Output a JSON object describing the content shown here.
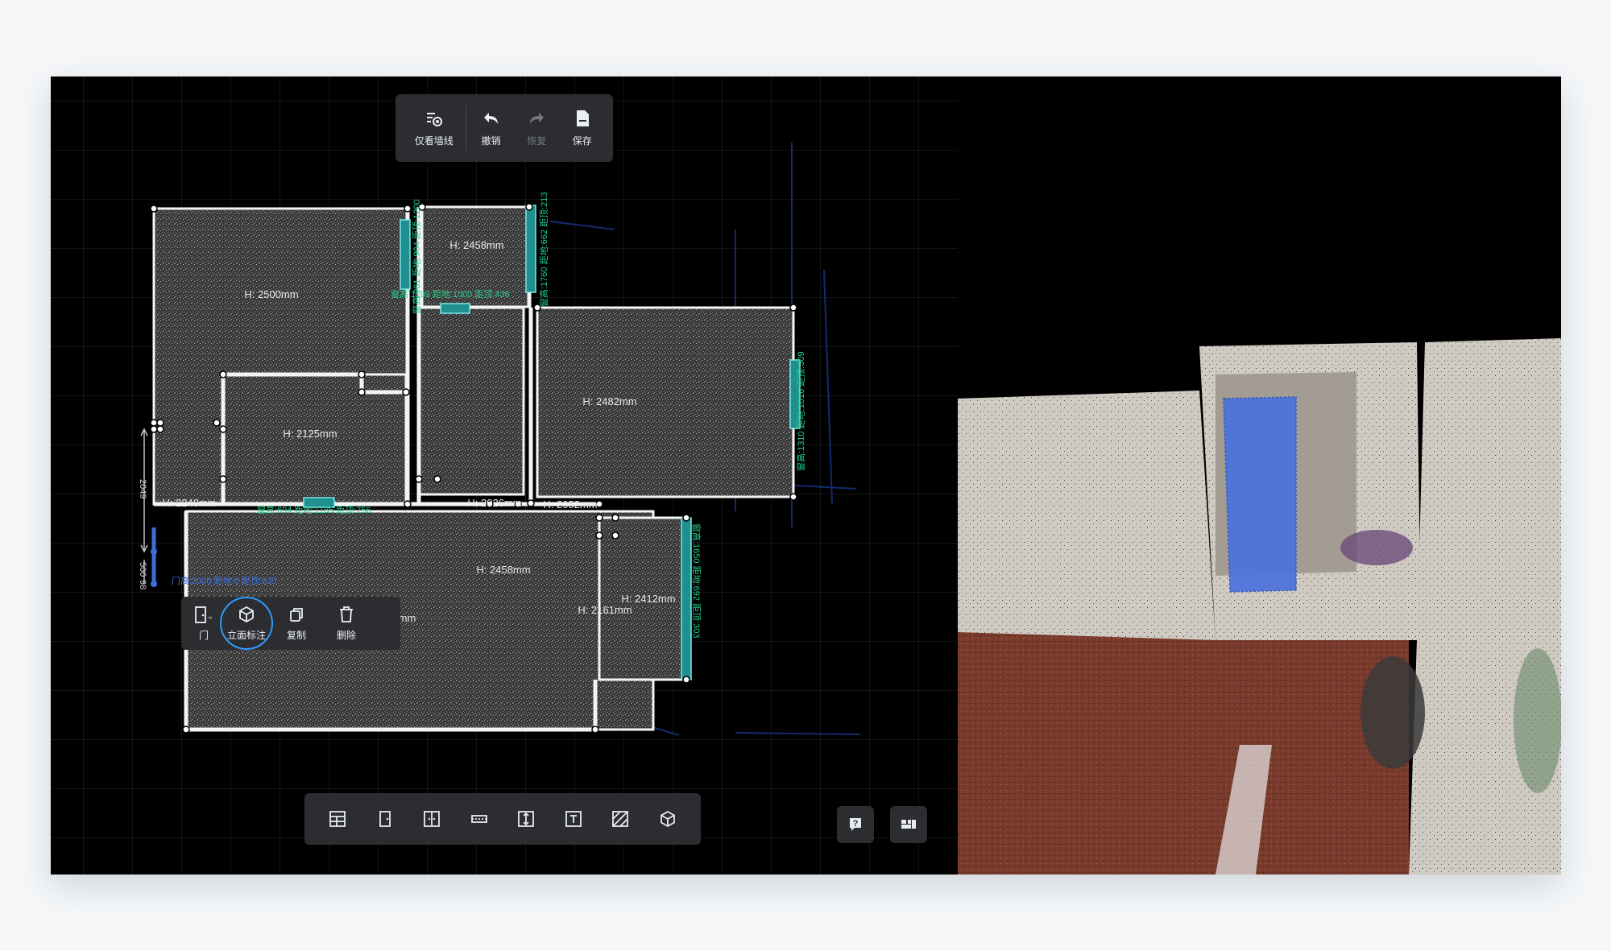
{
  "top_toolbar": {
    "walls_only": "仅看墙线",
    "undo": "撤销",
    "redo": "恢复",
    "save": "保存"
  },
  "context_toolbar": {
    "door": "门",
    "elevation": "立面标注",
    "copy": "复制",
    "delete": "删除"
  },
  "rooms": {
    "r1": "H: 2500mm",
    "r2": "H: 2458mm",
    "r3": "H: 2125mm",
    "r4": "H: 2482mm",
    "r5": "H: 2240mm",
    "r6": "H: 2026mm",
    "r7": "H: 2052mm",
    "r8": "H: 2458mm",
    "r9": "H: 2412mm",
    "r10": "H: 2161mm",
    "r11_partial": "2478mm"
  },
  "annotations": {
    "win_top_left": "窗高:1199 距地:1000 距顶:436",
    "win_v1": "窗高:961 距地:904 距顶:1200",
    "win_v2": "窗高:1760 距地:662 距顶:213",
    "win_right": "窗高:1310 距地:1016 距顶:309",
    "win_bottom_mid": "窗高:694 距地:1185 距顶:756",
    "win_right_lower": "窗高:1650 距地:692 距顶:303",
    "door_label": "门高:2000 距地:0 距顶:635",
    "dim_2049": "2049",
    "dim_500": "500",
    "dim_98": "98"
  },
  "colors": {
    "accent": "#2e9bff",
    "window_green": "#1fd08a",
    "window_fill": "#1f8f8f",
    "door_blue": "#3e6fd8",
    "toolbar_bg": "#2b2d31"
  },
  "icons": {
    "walls_only": "walls-eye-icon",
    "undo": "undo-icon",
    "redo": "redo-icon",
    "save": "save-icon",
    "door": "door-icon",
    "elevation": "cube-icon",
    "copy": "copy-icon",
    "delete": "trash-icon",
    "help": "help-icon",
    "layout": "layout-icon",
    "collapse": "collapse-icon"
  }
}
